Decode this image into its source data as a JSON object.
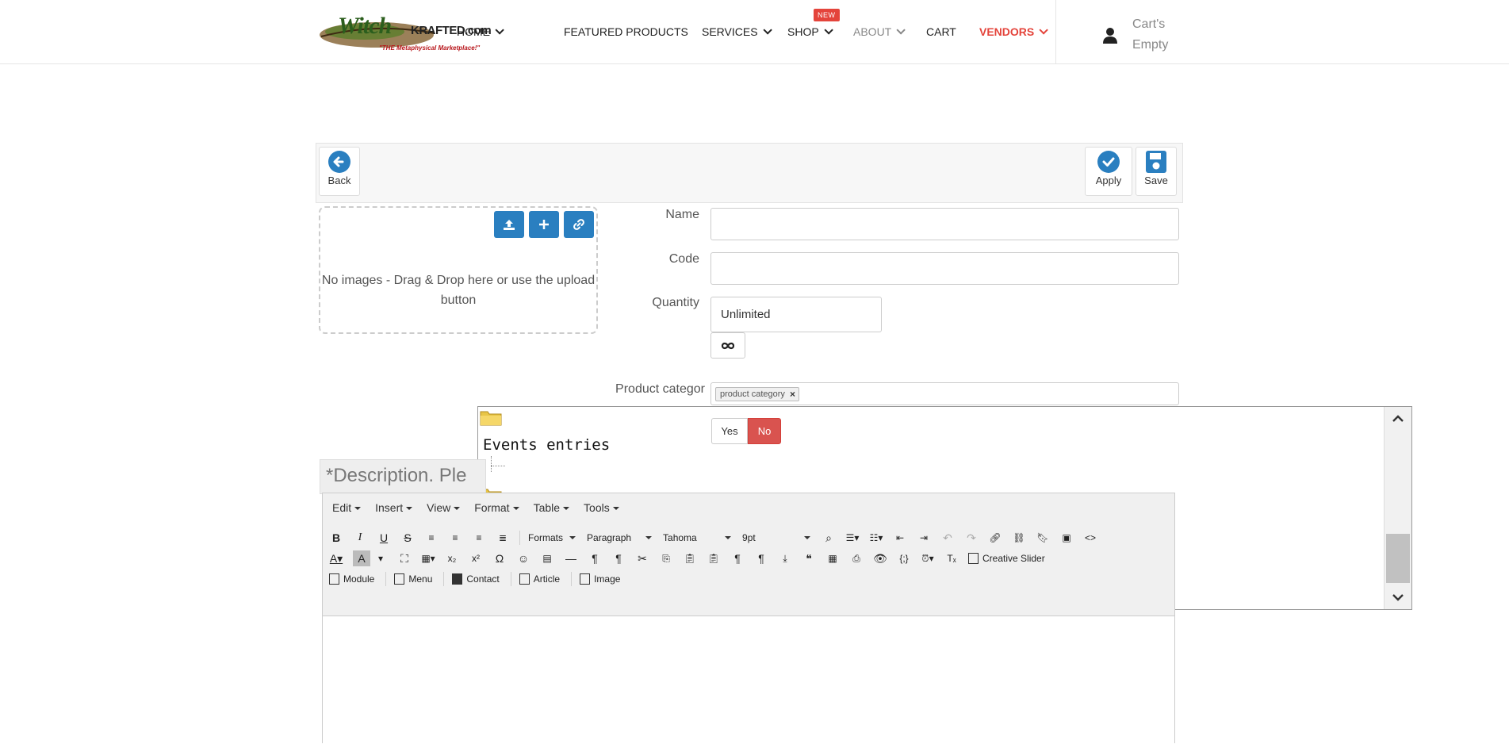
{
  "header": {
    "logo": {
      "word1": "Witch",
      "word2": "KRAFTED.com",
      "tagline": "\"THE Metaphysical Marketplace!\""
    },
    "nav": [
      {
        "label": "HOME",
        "has_dropdown": true
      },
      {
        "label": "FEATURED PRODUCTS",
        "has_dropdown": false
      },
      {
        "label": "SERVICES",
        "has_dropdown": true
      },
      {
        "label": "SHOP",
        "has_dropdown": true,
        "badge": "NEW"
      },
      {
        "label": "ABOUT",
        "has_dropdown": true
      },
      {
        "label": "CART",
        "has_dropdown": false
      },
      {
        "label": "VENDORS",
        "has_dropdown": true
      }
    ],
    "cart": {
      "line1": "Cart's",
      "line2": "Empty",
      "icon": "user-icon"
    }
  },
  "toolbar": {
    "back_label": "Back",
    "apply_label": "Apply",
    "save_label": "Save"
  },
  "images": {
    "empty_text": "No images - Drag & Drop here or use the upload button",
    "buttons": [
      "upload-icon",
      "plus-icon",
      "link-icon"
    ]
  },
  "form": {
    "name": {
      "label": "Name",
      "value": ""
    },
    "code": {
      "label": "Code",
      "value": ""
    },
    "quantity": {
      "label": "Quantity",
      "value": "Unlimited"
    },
    "category": {
      "label": "Product categor",
      "chip": "product category"
    },
    "toggle": {
      "yes": "Yes",
      "no": "No",
      "selected": "No"
    }
  },
  "tree": {
    "title": "Events entries"
  },
  "description": {
    "title": "*Description. Ple",
    "menus": [
      "Edit",
      "Insert",
      "View",
      "Format",
      "Table",
      "Tools"
    ],
    "formats_label": "Formats",
    "block_label": "Paragraph",
    "font_label": "Tahoma",
    "size_label": "9pt",
    "creative_slider": "Creative Slider",
    "module": "Module",
    "menu": "Menu",
    "contact": "Contact",
    "article": "Article",
    "image": "Image"
  },
  "colors": {
    "primary_blue": "#2a7fc0",
    "danger_red": "#d9534f",
    "vendors_red": "#e4443b",
    "badge_red": "#e4443b"
  }
}
